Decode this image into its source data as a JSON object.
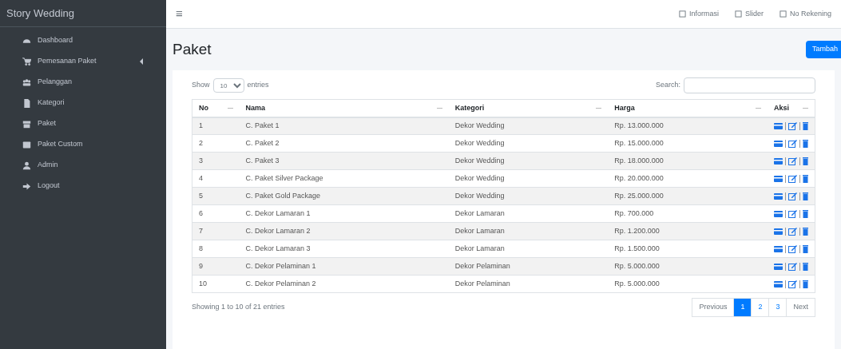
{
  "brand": "Story Wedding",
  "sidebar": {
    "items": [
      {
        "label": "Dashboard",
        "has_children": false
      },
      {
        "label": "Pemesanan Paket",
        "has_children": true
      },
      {
        "label": "Pelanggan",
        "has_children": false
      },
      {
        "label": "Kategori",
        "has_children": false
      },
      {
        "label": "Paket",
        "has_children": false
      },
      {
        "label": "Paket Custom",
        "has_children": false
      },
      {
        "label": "Admin",
        "has_children": false
      },
      {
        "label": "Logout",
        "has_children": false
      }
    ]
  },
  "topbar": {
    "menu_glyph": "≡",
    "links": [
      "Informasi",
      "Slider",
      "No Rekening"
    ]
  },
  "page_title": "Paket",
  "add_button": "Tambah",
  "table_controls": {
    "show_label": "Show",
    "page_size": "10",
    "entries_label": "entries",
    "search_label": "Search:"
  },
  "table": {
    "columns": [
      "No",
      "Nama",
      "Kategori",
      "Harga",
      "Aksi"
    ],
    "rows": [
      [
        "1",
        "C. Paket 1",
        "Dekor Wedding",
        "Rp. 13.000.000"
      ],
      [
        "2",
        "C. Paket 2",
        "Dekor Wedding",
        "Rp. 15.000.000"
      ],
      [
        "3",
        "C. Paket 3",
        "Dekor Wedding",
        "Rp. 18.000.000"
      ],
      [
        "4",
        "C. Paket Silver Package",
        "Dekor Wedding",
        "Rp. 20.000.000"
      ],
      [
        "5",
        "C. Paket Gold Package",
        "Dekor Wedding",
        "Rp. 25.000.000"
      ],
      [
        "6",
        "C. Dekor Lamaran 1",
        "Dekor Lamaran",
        "Rp. 700.000"
      ],
      [
        "7",
        "C. Dekor Lamaran 2",
        "Dekor Lamaran",
        "Rp. 1.200.000"
      ],
      [
        "8",
        "C. Dekor Lamaran 3",
        "Dekor Lamaran",
        "Rp. 1.500.000"
      ],
      [
        "9",
        "C. Dekor Pelaminan 1",
        "Dekor Pelaminan",
        "Rp. 5.000.000"
      ],
      [
        "10",
        "C. Dekor Pelaminan 2",
        "Dekor Pelaminan",
        "Rp. 5.000.000"
      ]
    ]
  },
  "info": "Showing 1 to 10 of 21 entries",
  "pagination": [
    {
      "label": "Previous",
      "kind": "nav",
      "selected": false
    },
    {
      "label": "1",
      "kind": "page",
      "selected": true
    },
    {
      "label": "2",
      "kind": "page",
      "selected": false
    },
    {
      "label": "3",
      "kind": "page",
      "selected": false
    },
    {
      "label": "Next",
      "kind": "nav",
      "selected": false
    }
  ]
}
